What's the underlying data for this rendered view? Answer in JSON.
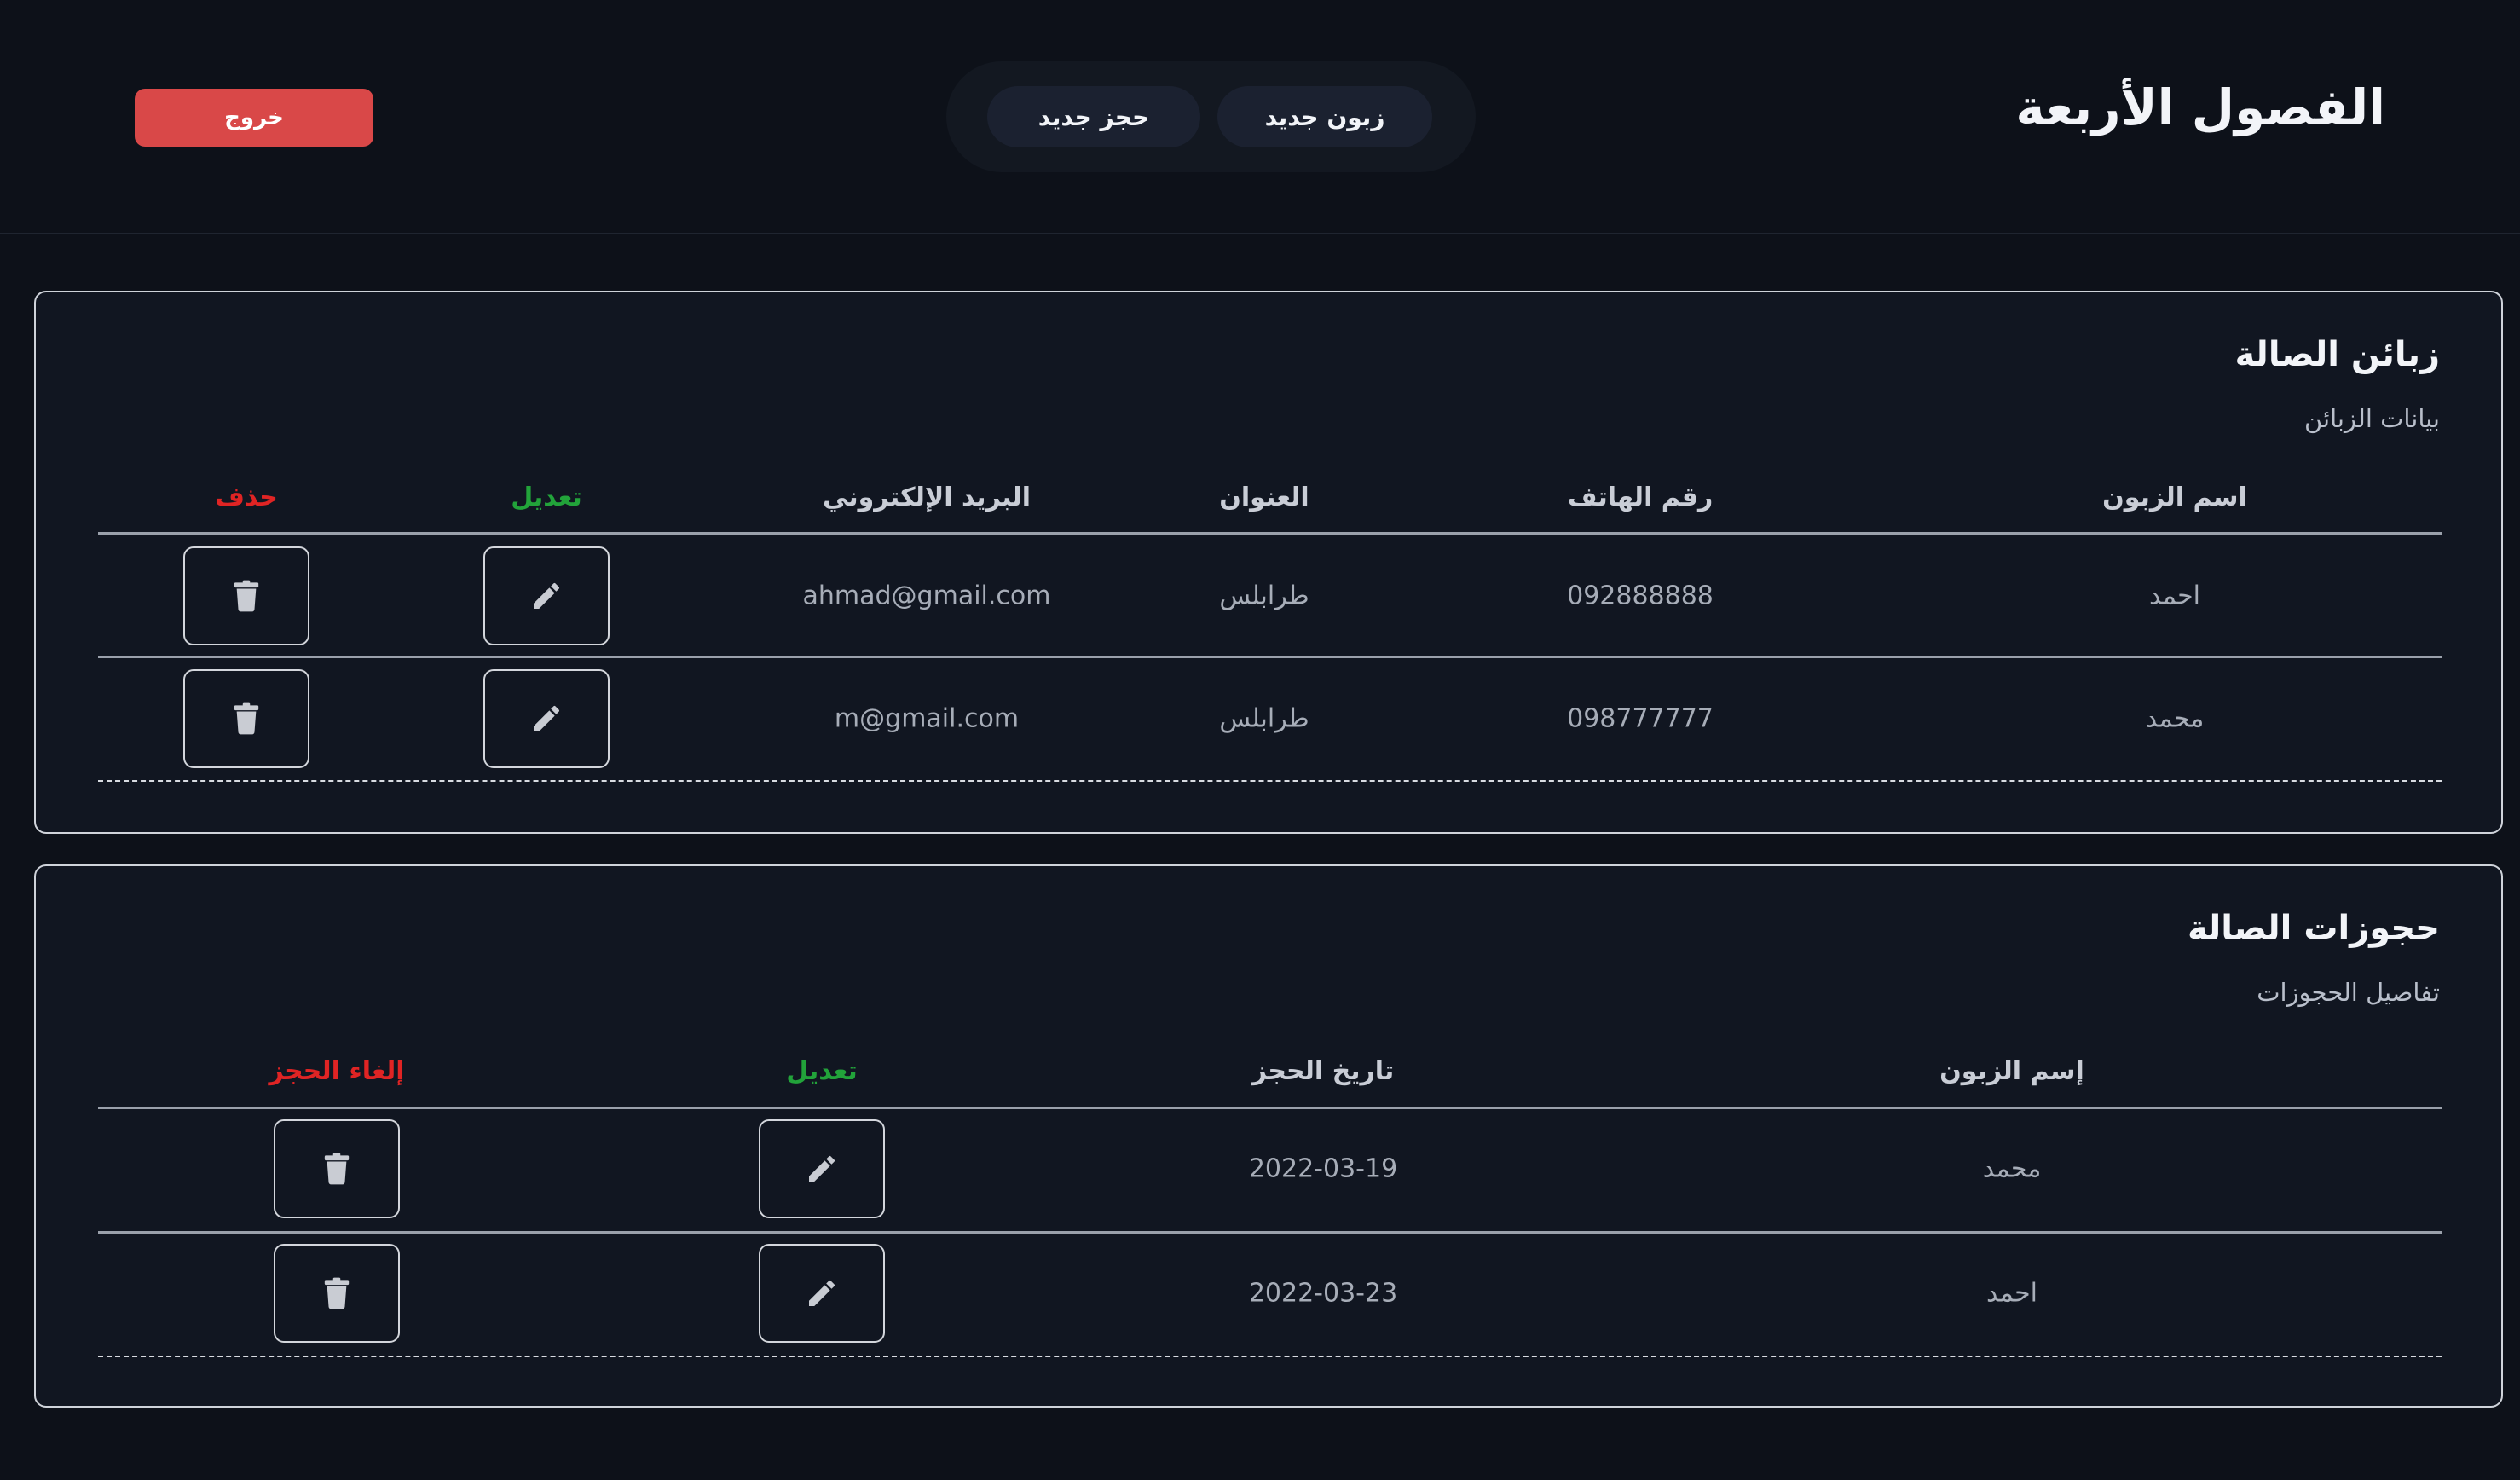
{
  "header": {
    "brand": "الفصول الأربعة",
    "nav": {
      "new_customer": "زبون جديد",
      "new_booking": "حجز جديد"
    },
    "logout": "خروج"
  },
  "customers": {
    "title": "زبائن الصالة",
    "subtitle": "بيانات الزبائن",
    "columns": {
      "name": "اسم الزبون",
      "phone": "رقم الهاتف",
      "address": "العنوان",
      "email": "البريد الإلكتروني",
      "edit": "تعديل",
      "delete": "حذف"
    },
    "rows": [
      {
        "name": "احمد",
        "phone": "092888888",
        "address": "طرابلس",
        "email": "ahmad@gmail.com"
      },
      {
        "name": "محمد",
        "phone": "098777777",
        "address": "طرابلس",
        "email": "m@gmail.com"
      }
    ]
  },
  "bookings": {
    "title": "حجوزات الصالة",
    "subtitle": "تفاصيل الحجوزات",
    "columns": {
      "name": "إسم الزبون",
      "date": "تاريخ الحجز",
      "edit": "تعديل",
      "cancel": "إلغاء الحجز"
    },
    "rows": [
      {
        "name": "محمد",
        "date": "2022-03-19"
      },
      {
        "name": "احمد",
        "date": "2022-03-23"
      }
    ]
  },
  "icons": {
    "edit": "pencil-icon",
    "delete": "trash-icon"
  },
  "colors": {
    "background": "#0d1119",
    "card": "#111621",
    "logout": "#d94848",
    "edit_header": "#22a33a",
    "delete_header": "#e02424"
  }
}
